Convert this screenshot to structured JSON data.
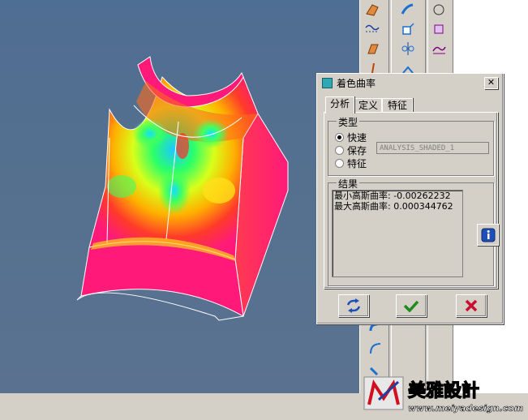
{
  "dialog": {
    "title": "着色曲率",
    "close_label": "✕",
    "tabs": [
      {
        "label": "分析",
        "active": true
      },
      {
        "label": "定义",
        "active": false
      },
      {
        "label": "特征",
        "active": false
      }
    ],
    "type_group": {
      "legend": "类型",
      "options": [
        {
          "label": "快速",
          "selected": true
        },
        {
          "label": "保存",
          "selected": false
        },
        {
          "label": "特征",
          "selected": false
        }
      ],
      "name_value": "ANALYSIS_SHADED_1"
    },
    "results_group": {
      "legend": "结果",
      "lines": [
        "最小高斯曲率: -0.00262232",
        "最大高斯曲率: 0.000344762"
      ]
    },
    "info_icon": "info-icon",
    "buttons": {
      "repaint_icon": "repaint-icon",
      "ok_icon": "check-icon",
      "cancel_icon": "cross-icon"
    }
  },
  "watermark": {
    "brand": "美雅設計",
    "url": "www.meiyadesign.com"
  },
  "colors": {
    "viewport_bg": "#55708f",
    "ok_green": "#1f8a1f",
    "cancel_red": "#c8102e",
    "info_blue": "#1e4fb8",
    "surface_magenta": "#ff1a7a"
  }
}
